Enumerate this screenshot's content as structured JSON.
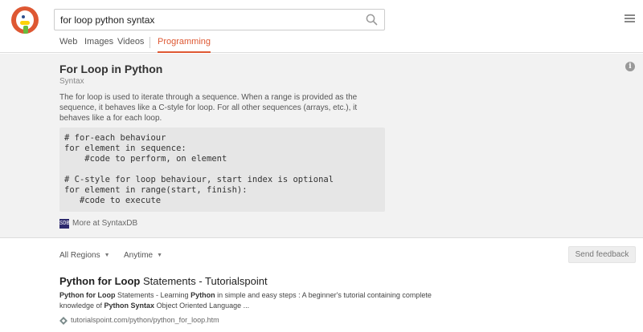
{
  "search": {
    "query": "for loop python syntax"
  },
  "tabs": [
    {
      "label": "Web"
    },
    {
      "label": "Images"
    },
    {
      "label": "Videos"
    },
    {
      "label": "Programming",
      "active": true
    }
  ],
  "instant_answer": {
    "title": "For Loop in Python",
    "subtitle": "Syntax",
    "description": "The for loop is used to iterate through a sequence. When a range is provided as the sequence, it behaves like a C-style for loop. For all other sequences (arrays, etc.), it behaves like a for each loop.",
    "code_lines": [
      "# for-each behaviour",
      "for element in sequence:",
      "    #code to perform, on element",
      "",
      "# C-style for loop behaviour, start index is optional",
      "for element in range(start, finish):",
      "   #code to execute"
    ],
    "source_icon_text": "SDB",
    "more_link": "More at SyntaxDB"
  },
  "filters": {
    "region": "All Regions",
    "time": "Anytime",
    "feedback": "Send feedback"
  },
  "result": {
    "title_bold": "Python for Loop",
    "title_rest": " Statements - Tutorialspoint",
    "snippet": [
      {
        "t": "Python for Loop",
        "b": true
      },
      {
        "t": " Statements - Learning "
      },
      {
        "t": "Python",
        "b": true
      },
      {
        "t": " in simple and easy steps : A beginner's tutorial containing complete knowledge of "
      },
      {
        "t": "Python Syntax",
        "b": true
      },
      {
        "t": " Object Oriented Language ..."
      }
    ],
    "url": "tutorialspoint.com/python/python_for_loop.htm"
  },
  "colors": {
    "accent": "#de5833",
    "panel_bg": "#f2f2f2",
    "code_bg": "#e6e6e6"
  },
  "icons": [
    "duckduckgo-logo",
    "search-icon",
    "menu-icon",
    "info-icon",
    "syntaxdb-icon",
    "caret-down-icon",
    "globe-icon"
  ]
}
